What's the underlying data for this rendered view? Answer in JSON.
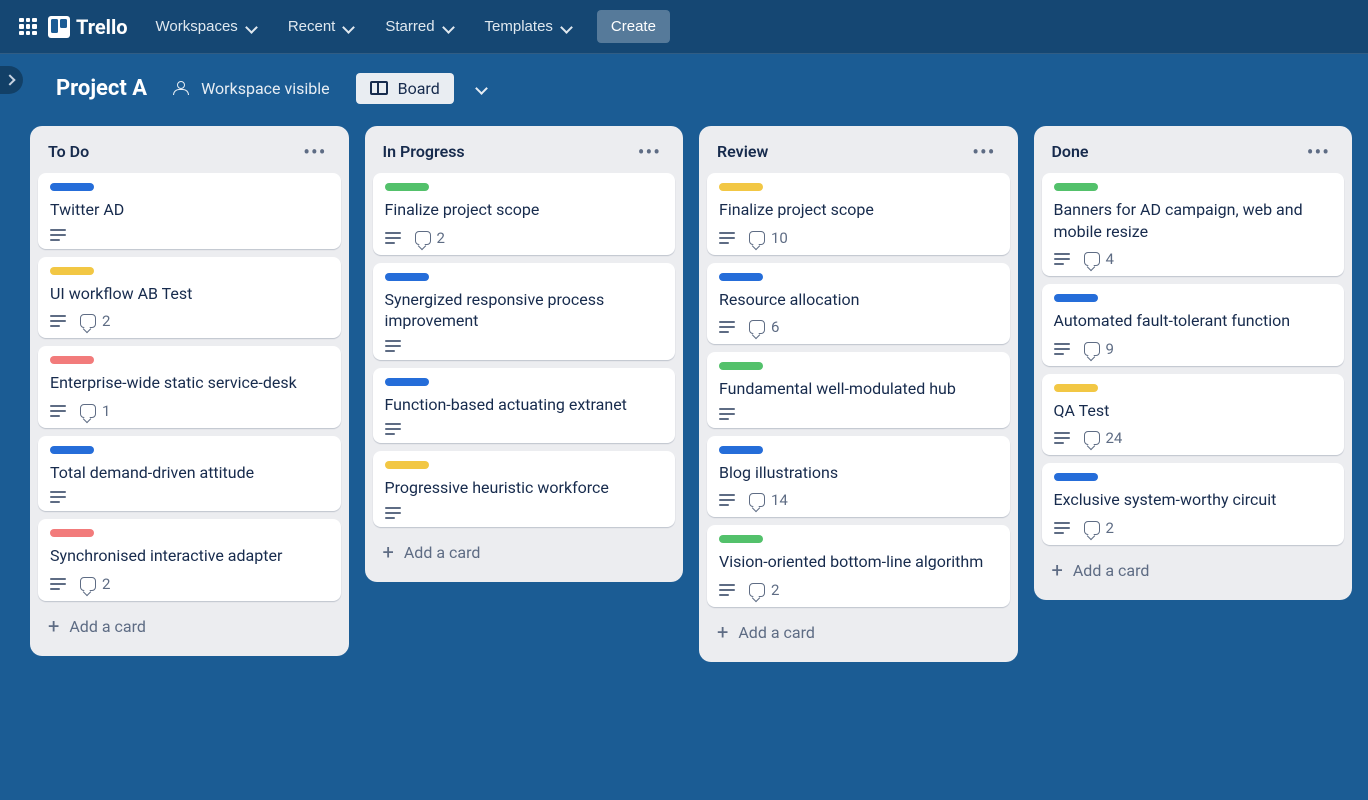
{
  "app_name": "Trello",
  "nav": {
    "workspaces": "Workspaces",
    "recent": "Recent",
    "starred": "Starred",
    "templates": "Templates",
    "create": "Create"
  },
  "board_header": {
    "title": "Project A",
    "visibility": "Workspace visible",
    "view": "Board"
  },
  "add_card_label": "Add a card",
  "colors": {
    "blue": "#256dd9",
    "yellow": "#f2c744",
    "green": "#53c16b",
    "red": "#f27b7b"
  },
  "lists": [
    {
      "title": "To Do",
      "cards": [
        {
          "label": "blue",
          "title": "Twitter AD",
          "has_desc": true
        },
        {
          "label": "yellow",
          "title": "UI workflow AB Test",
          "has_desc": true,
          "comments": 2
        },
        {
          "label": "red",
          "title": "Enterprise-wide static service-desk",
          "has_desc": true,
          "comments": 1
        },
        {
          "label": "blue",
          "title": "Total demand-driven attitude",
          "has_desc": true
        },
        {
          "label": "red",
          "title": "Synchronised interactive adapter",
          "has_desc": true,
          "comments": 2
        }
      ]
    },
    {
      "title": "In Progress",
      "cards": [
        {
          "label": "green",
          "title": "Finalize project scope",
          "has_desc": true,
          "comments": 2
        },
        {
          "label": "blue",
          "title": "Synergized responsive process improvement",
          "has_desc": true
        },
        {
          "label": "blue",
          "title": "Function-based actuating extranet",
          "has_desc": true
        },
        {
          "label": "yellow",
          "title": "Progressive heuristic workforce",
          "has_desc": true
        }
      ]
    },
    {
      "title": "Review",
      "cards": [
        {
          "label": "yellow",
          "title": "Finalize project scope",
          "has_desc": true,
          "comments": 10
        },
        {
          "label": "blue",
          "title": "Resource allocation",
          "has_desc": true,
          "comments": 6
        },
        {
          "label": "green",
          "title": "Fundamental well-modulated hub",
          "has_desc": true
        },
        {
          "label": "blue",
          "title": "Blog illustrations",
          "has_desc": true,
          "comments": 14
        },
        {
          "label": "green",
          "title": "Vision-oriented bottom-line algorithm",
          "has_desc": true,
          "comments": 2
        }
      ]
    },
    {
      "title": "Done",
      "cards": [
        {
          "label": "green",
          "title": "Banners for AD campaign, web and mobile resize",
          "has_desc": true,
          "comments": 4
        },
        {
          "label": "blue",
          "title": "Automated fault-tolerant function",
          "has_desc": true,
          "comments": 9
        },
        {
          "label": "yellow",
          "title": "QA Test",
          "has_desc": true,
          "comments": 24
        },
        {
          "label": "blue",
          "title": "Exclusive system-worthy circuit",
          "has_desc": true,
          "comments": 2
        }
      ]
    }
  ]
}
